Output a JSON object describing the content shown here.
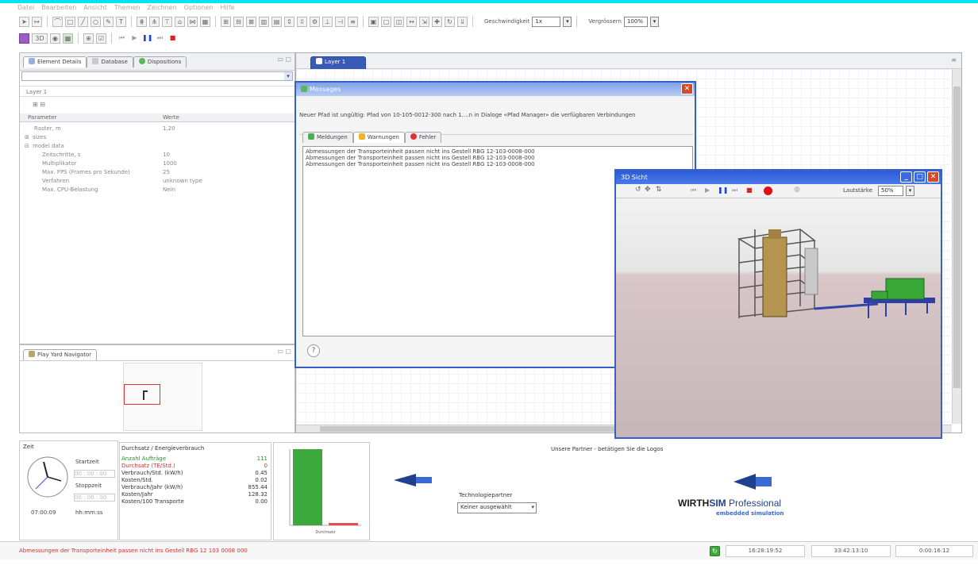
{
  "menu": [
    "Datei",
    "Bearbeiten",
    "Ansicht",
    "Themen",
    "Zeichnen",
    "Optionen",
    "Hilfe"
  ],
  "toolbar": {
    "speed_label": "Geschwindigkeit",
    "speed_value": "1x",
    "zoom_label": "Vergrössern",
    "zoom_value": "100%",
    "mode_3d": "3D"
  },
  "left_tabs": [
    "Element Details",
    "Database",
    "Dispositions"
  ],
  "layer_title": "Layer 1",
  "table": {
    "col_param": "Parameter",
    "col_value": "Werte",
    "rows": [
      {
        "name": "Raster, m",
        "value": "1,20",
        "indent": 1
      },
      {
        "name": "sizes",
        "value": "",
        "indent": 0
      },
      {
        "name": "model data",
        "value": "",
        "indent": 0
      },
      {
        "name": "Zeitschritte, s",
        "value": "10",
        "indent": 2
      },
      {
        "name": "Multiplikator",
        "value": "1000",
        "indent": 2
      },
      {
        "name": "Max. FPS (Frames pro Sekunde)",
        "value": "25",
        "indent": 2
      },
      {
        "name": "Verfahren",
        "value": "unknown type",
        "indent": 2
      },
      {
        "name": "Max. CPU-Belastung",
        "value": "Nein",
        "indent": 2
      }
    ]
  },
  "navigator_tab": "Play Yard Navigator",
  "canvas_tab": "Layer 1",
  "messages": {
    "title": "Messages",
    "header": "Neuer Pfad ist ungültig: Pfad von 10-105-0012-300 nach 1....n in Dialoge «Pfad Manager» die verfügbaren Verbindungen",
    "tabs": [
      "Meldungen",
      "Warnungen",
      "Fehler"
    ],
    "lines": [
      "Abmessungen der Transporteinheit passen nicht ins Gestell RBG 12-103-0008-000",
      "Abmessungen der Transporteinheit passen nicht ins Gestell RBG 12-103-0008-000",
      "Abmessungen der Transporteinheit passen nicht ins Gestell RBG 12-103-0008-000"
    ],
    "help": "?"
  },
  "view3d": {
    "title": "3D Sicht",
    "volume_label": "Lautstärke",
    "volume_value": "50%"
  },
  "clock": {
    "title": "Zeit",
    "start_label": "Startzeit",
    "stop_label": "Stoppzeit",
    "start_value": "00 : 00 : 00",
    "stop_value": "00 : 00 : 00",
    "time_value": "07:00:09",
    "format": "hh:mm:ss"
  },
  "stats": {
    "title": "Durchsatz / Energieverbrauch",
    "rows": [
      {
        "label": "Anzahl Aufträge",
        "value": "111",
        "color": "#2a8f2a"
      },
      {
        "label": "Durchsatz (TE/Std.)",
        "value": "0",
        "color": "#d23030"
      },
      {
        "label": "Verbrauch/Std. (kW/h)",
        "value": "0.45",
        "color": "#333333"
      },
      {
        "label": "Kosten/Std.",
        "value": "0.02",
        "color": "#333333"
      },
      {
        "label": "Verbrauch/Jahr (kW/h)",
        "value": "855.44",
        "color": "#333333"
      },
      {
        "label": "Kosten/Jahr",
        "value": "128.32",
        "color": "#333333"
      },
      {
        "label": "Kosten/100 Transporte",
        "value": "0.00",
        "color": "#333333"
      }
    ]
  },
  "chart_data": {
    "type": "bar",
    "categories": [
      "Anzahl Aufträge",
      "Durchsatz"
    ],
    "values": [
      111,
      0
    ],
    "colors": [
      "#3da83d",
      "#e05050"
    ],
    "xlabel": "Durchsatz",
    "ylim": [
      0,
      111
    ]
  },
  "partners": {
    "title": "Unsere Partner - betätigen Sie die Logos",
    "tech_label": "Technologiepartner",
    "combo_value": "Keiner ausgewählt",
    "brand_a": "WIRTH",
    "brand_b": "SIM",
    "brand_c": " Professional",
    "tagline": "embedded simulation"
  },
  "status": {
    "message": "Abmessungen der Transporteinheit passen nicht ins Gestell RBG 12 103 0008 000",
    "time1": "16:28:19:52",
    "time2": "33:42:13:10",
    "time3": "0:00:16:12"
  }
}
